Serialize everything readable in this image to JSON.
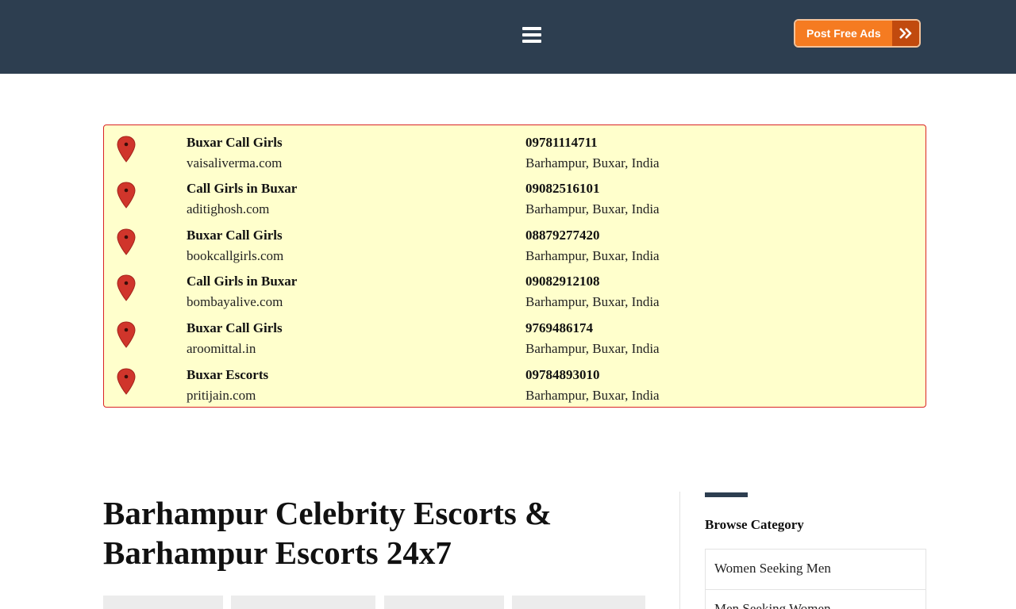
{
  "header": {
    "menu_icon": "hamburger-menu-icon",
    "post_button_label": "Post Free Ads",
    "post_button_icon": "double-chevron-right-icon",
    "colors": {
      "bar": "#2d3e50",
      "button": "#f57b21",
      "button_arrow": "#c14a0e"
    }
  },
  "listings": [
    {
      "name": "Buxar Call Girls",
      "site": "vaisaliverma.com",
      "phone": "09781114711",
      "location": "Barhampur, Buxar, India"
    },
    {
      "name": "Call Girls in Buxar",
      "site": "aditighosh.com",
      "phone": "09082516101",
      "location": "Barhampur, Buxar, India"
    },
    {
      "name": "Buxar Call Girls",
      "site": "bookcallgirls.com",
      "phone": "08879277420",
      "location": "Barhampur, Buxar, India"
    },
    {
      "name": "Call Girls in Buxar",
      "site": "bombayalive.com",
      "phone": "09082912108",
      "location": "Barhampur, Buxar, India"
    },
    {
      "name": "Buxar Call Girls",
      "site": "aroomittal.in",
      "phone": "9769486174",
      "location": "Barhampur, Buxar, India"
    },
    {
      "name": "Buxar Escorts",
      "site": "pritijain.com",
      "phone": "09784893010",
      "location": "Barhampur, Buxar, India"
    }
  ],
  "listing_icon": "map-pin-icon",
  "listing_colors": {
    "background": "#ffffcc",
    "border": "#d92424",
    "pin": "#d0352b"
  },
  "main": {
    "title": "Barhampur Celebrity Escorts & Barhampur Escorts 24x7"
  },
  "sidebar": {
    "title": "Browse Category",
    "categories": [
      "Women Seeking Men",
      "Men Seeking Women"
    ]
  }
}
